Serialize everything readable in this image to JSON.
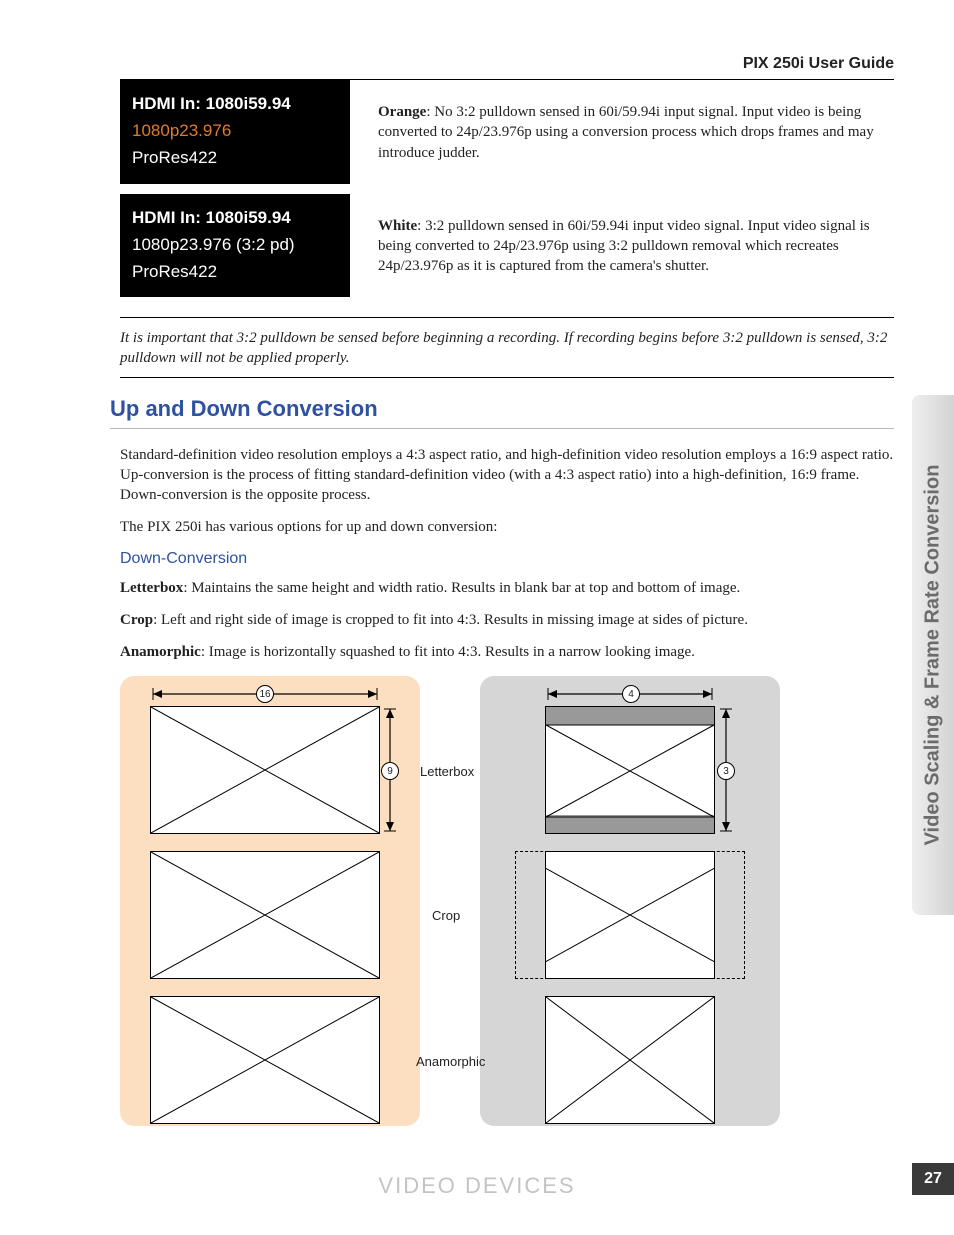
{
  "header": {
    "title": "PIX 250i User Guide"
  },
  "lcd": {
    "orange": {
      "line1": "HDMI In: 1080i59.94",
      "line2": "1080p23.976",
      "line3": "ProRes422"
    },
    "white": {
      "line1": "HDMI In: 1080i59.94",
      "line2": "1080p23.976 (3:2 pd)",
      "line3": "ProRes422"
    },
    "desc_orange_label": "Orange",
    "desc_orange_text": ": No 3:2 pulldown sensed in 60i/59.94i input signal. Input video is being converted to 24p/23.976p using a conversion process which drops frames and may introduce judder.",
    "desc_white_label": "White",
    "desc_white_text": ": 3:2 pulldown sensed in 60i/59.94i input video signal. Input video signal is being converted to 24p/23.976p using 3:2 pulldown removal which recreates 24p/23.976p as it is captured from the camera's shutter."
  },
  "note": "It is important that 3:2 pulldown be sensed before beginning a recording. If recording begins before 3:2 pulldown is sensed, 3:2 pulldown will not be applied properly.",
  "section": {
    "title": "Up and Down Conversion",
    "p1": "Standard-definition video resolution employs a 4:3 aspect ratio, and high-definition video resolution employs a 16:9 aspect ratio. Up-conversion is the process of fitting standard-definition video (with a 4:3 aspect ratio) into a high-definition, 16:9 frame. Down-conversion is the opposite process.",
    "p2": "The PIX 250i has various options for up and down conversion:"
  },
  "down": {
    "heading": "Down-Conversion",
    "letterbox_label": "Letterbox",
    "letterbox_text": ": Maintains the same height and width ratio. Results in blank bar at top and bottom of image.",
    "crop_label": "Crop",
    "crop_text": ": Left and right side of image is cropped to fit into 4:3. Results in missing image at sides of picture.",
    "anamorphic_label": "Anamorphic",
    "anamorphic_text": ": Image is horizontally squashed to fit into 4:3. Results in a narrow looking image."
  },
  "diagram": {
    "labels": {
      "letterbox": "Letterbox",
      "crop": "Crop",
      "anamorphic": "Anamorphic"
    },
    "aspect_left_w": "16",
    "aspect_left_h": "9",
    "aspect_right_w": "4",
    "aspect_right_h": "3"
  },
  "side_tab": "Video Scaling & Frame Rate Conversion",
  "page_number": "27",
  "footer_brand": "VIDEO  DEVICES"
}
